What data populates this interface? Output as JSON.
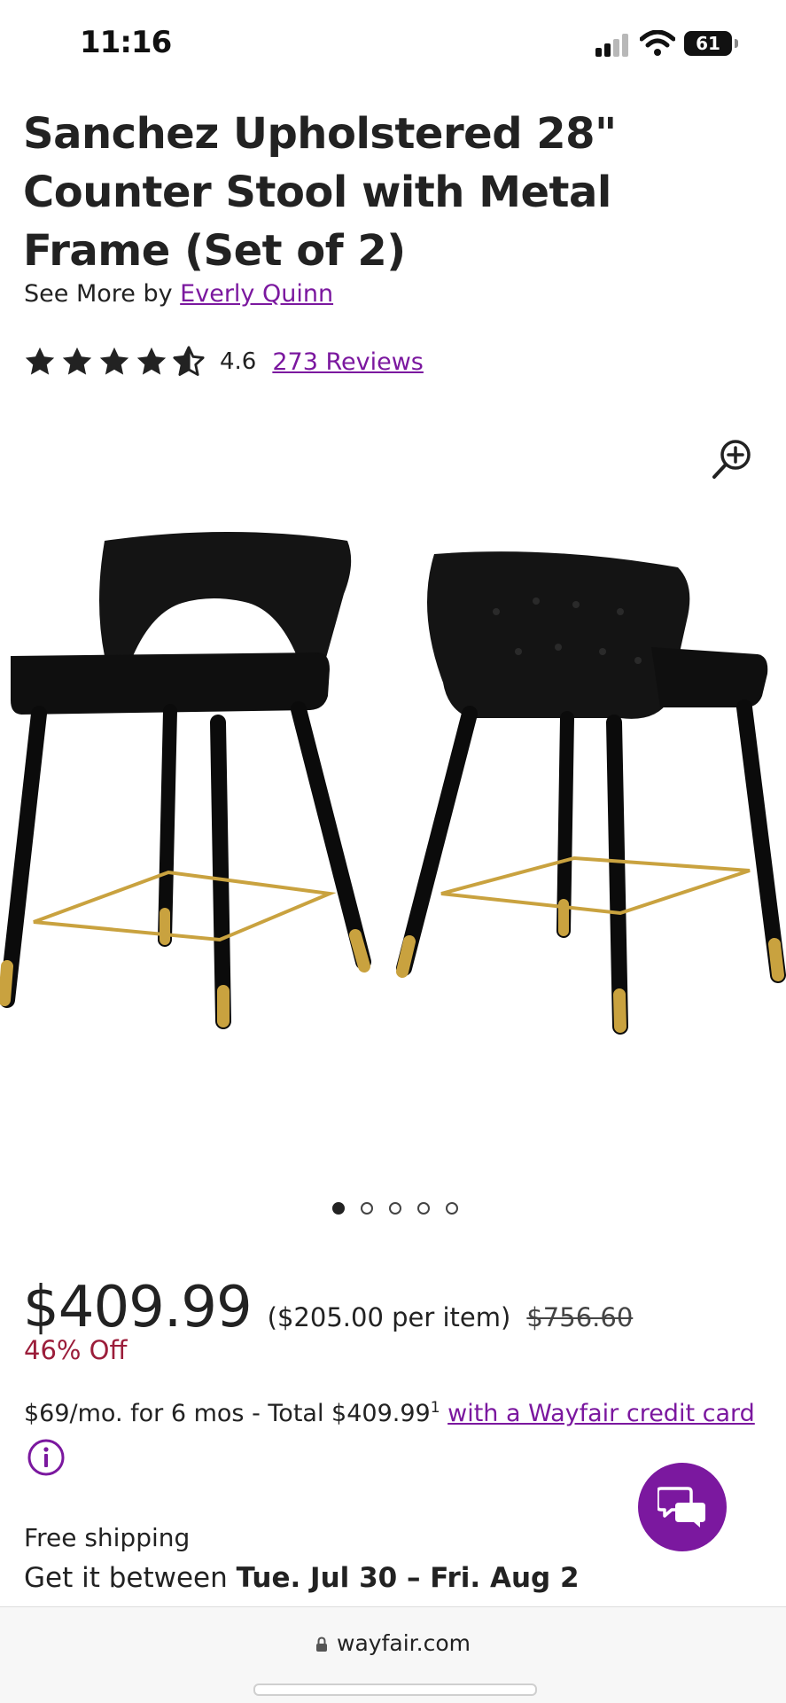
{
  "status_bar": {
    "time": "11:16",
    "battery": "61"
  },
  "product": {
    "title": "Sanchez Upholstered 28\" Counter Stool with Metal Frame (Set of 2)",
    "see_more_prefix": "See More by",
    "brand": "Everly Quinn",
    "rating": 4.6,
    "rating_text": "4.6",
    "reviews_link": "273 Reviews",
    "gallery": {
      "image_subject": "Two black velvet counter stools with gold footrests and gold-tipped black legs",
      "total_images": 5,
      "active_index": 0
    },
    "price": "$409.99",
    "per_item": "($205.00 per item)",
    "was_price": "$756.60",
    "discount": "46% Off",
    "financing_text": "$69/mo. for 6 mos - Total $409.99",
    "financing_footnote": "1",
    "financing_link": "with a Wayfair credit card",
    "shipping_label": "Free shipping",
    "delivery_prefix": "Get it between",
    "delivery_dates": "Tue. Jul 30 – Fri. Aug 2"
  },
  "browser": {
    "url": "wayfair.com"
  },
  "colors": {
    "accent": "#7b189f",
    "discount": "#9b1d3a",
    "text": "#222222"
  },
  "icons": [
    "zoom-in-icon",
    "star-icon",
    "info-icon",
    "chat-icon",
    "lock-icon",
    "wifi-icon",
    "signal-icon",
    "battery-icon"
  ]
}
